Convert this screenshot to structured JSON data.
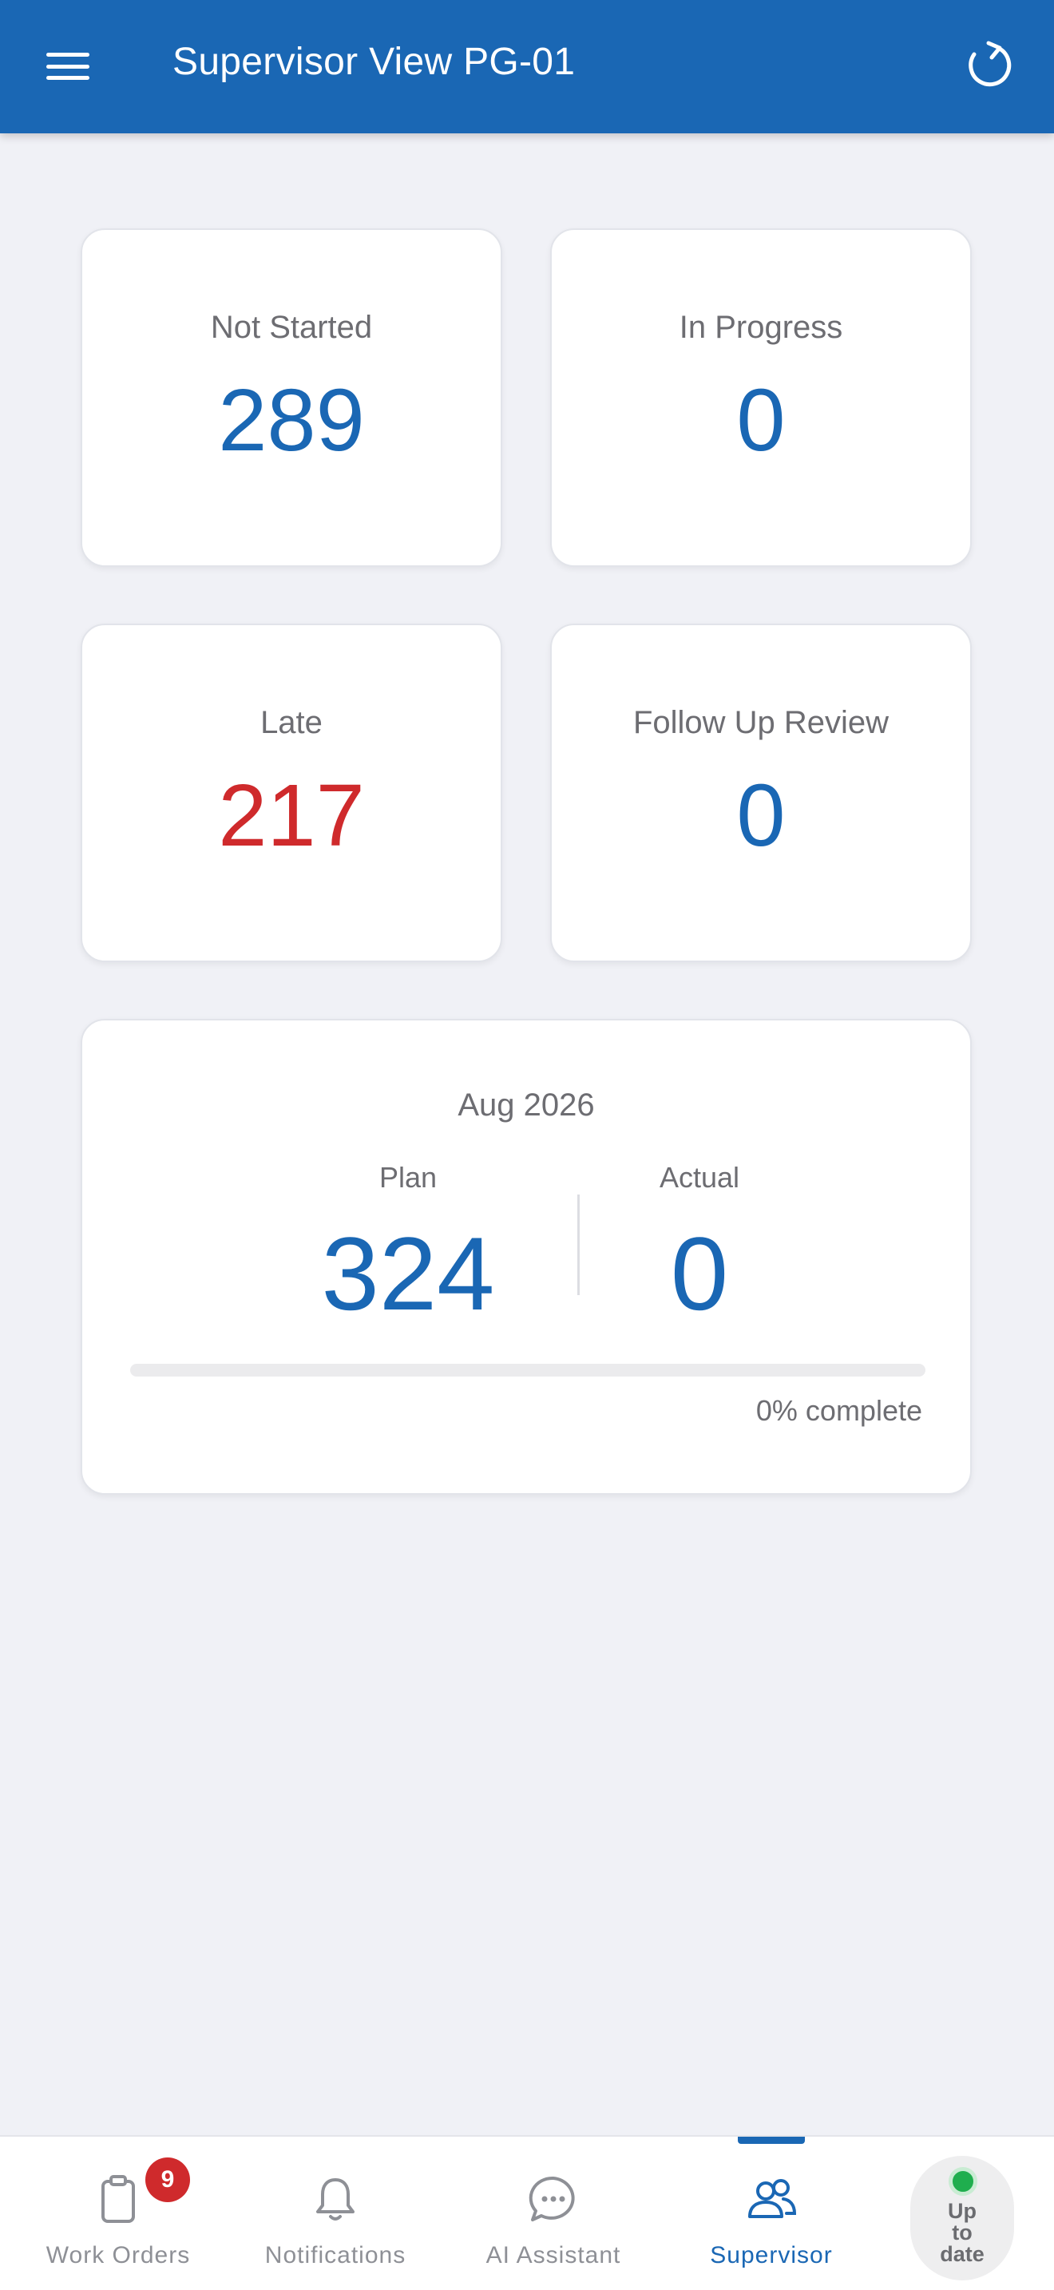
{
  "header": {
    "title": "Supervisor View PG-01",
    "menu_icon": "hamburger-menu-icon",
    "refresh_icon": "refresh-icon",
    "background_color": "#1a67b4"
  },
  "stats": {
    "not_started": {
      "label": "Not Started",
      "value": "289"
    },
    "in_progress": {
      "label": "In Progress",
      "value": "0"
    },
    "late": {
      "label": "Late",
      "value": "217",
      "color": "#cf2a2c"
    },
    "follow_up_review": {
      "label": "Follow Up Review",
      "value": "0"
    }
  },
  "plan_card": {
    "month": "Aug 2026",
    "plan_label": "Plan",
    "plan_value": "324",
    "actual_label": "Actual",
    "actual_value": "0",
    "progress_fraction": 0,
    "progress_text": "0% complete"
  },
  "bottom_nav": {
    "items": [
      {
        "label": "Work Orders",
        "icon": "clipboard-icon",
        "badge": "9"
      },
      {
        "label": "Notifications",
        "icon": "bell-icon"
      },
      {
        "label": "AI Assistant",
        "icon": "chat-bubble-icon"
      },
      {
        "label": "Supervisor",
        "icon": "people-icon",
        "active": true
      }
    ],
    "sync_status": {
      "text_line1": "Up",
      "text_line2": "to",
      "text_line3": "date",
      "dot_color": "#1fae4e"
    }
  },
  "colors": {
    "accent": "#1a67b4",
    "danger": "#cf2a2c",
    "background": "#f0f1f6"
  }
}
